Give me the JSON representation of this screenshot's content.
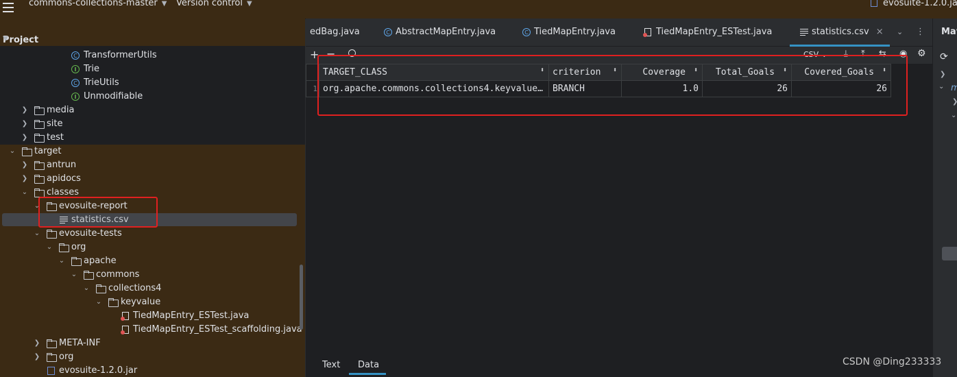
{
  "titlebar": {
    "project_name": "commons-collections-master",
    "vcs_label": "Version control",
    "jar_label": "evosuite-1.2.0.ja"
  },
  "project_panel": {
    "header": "Project",
    "tree": [
      {
        "label": "TransformerUtils",
        "icon": "class-icon"
      },
      {
        "label": "Trie",
        "icon": "interface-icon"
      },
      {
        "label": "TrieUtils",
        "icon": "class-icon"
      },
      {
        "label": "Unmodifiable",
        "icon": "interface-icon"
      },
      {
        "label": "media",
        "icon": "folder-icon"
      },
      {
        "label": "site",
        "icon": "folder-icon"
      },
      {
        "label": "test",
        "icon": "folder-icon"
      },
      {
        "label": "target",
        "icon": "folder-icon"
      },
      {
        "label": "antrun",
        "icon": "folder-icon"
      },
      {
        "label": "apidocs",
        "icon": "folder-icon"
      },
      {
        "label": "classes",
        "icon": "folder-icon"
      },
      {
        "label": "evosuite-report",
        "icon": "folder-icon"
      },
      {
        "label": "statistics.csv",
        "icon": "csv-file-icon"
      },
      {
        "label": "evosuite-tests",
        "icon": "folder-icon"
      },
      {
        "label": "org",
        "icon": "folder-icon"
      },
      {
        "label": "apache",
        "icon": "folder-icon"
      },
      {
        "label": "commons",
        "icon": "folder-icon"
      },
      {
        "label": "collections4",
        "icon": "folder-icon"
      },
      {
        "label": "keyvalue",
        "icon": "folder-icon"
      },
      {
        "label": "TiedMapEntry_ESTest.java",
        "icon": "java-test-file-icon"
      },
      {
        "label": "TiedMapEntry_ESTest_scaffolding.java",
        "icon": "java-test-file-icon"
      },
      {
        "label": "META-INF",
        "icon": "folder-icon"
      },
      {
        "label": "org",
        "icon": "folder-icon"
      },
      {
        "label": "evosuite-1.2.0.jar",
        "icon": "jar-icon"
      }
    ]
  },
  "editor": {
    "tabs": [
      {
        "label": "edBag.java"
      },
      {
        "label": "AbstractMapEntry.java"
      },
      {
        "label": "TiedMapEntry.java"
      },
      {
        "label": "TiedMapEntry_ESTest.java"
      },
      {
        "label": "statistics.csv"
      }
    ],
    "format_label": "CSV",
    "csv": {
      "headers": [
        "TARGET_CLASS",
        "criterion",
        "Coverage",
        "Total_Goals",
        "Covered_Goals"
      ],
      "rows": [
        {
          "num": "1",
          "cells": [
            "org.apache.commons.collections4.keyvalue…",
            "BRANCH",
            "1.0",
            "26",
            "26"
          ]
        }
      ]
    },
    "bottom_tabs": [
      "Text",
      "Data"
    ],
    "active_bottom_tab": "Data"
  },
  "right_panel": {
    "label": "Mav"
  },
  "watermark": "CSDN @Ding233333",
  "colors": {
    "accent": "#3592c4",
    "highlight_box": "#e02020",
    "title_bg": "#3b2a14"
  }
}
